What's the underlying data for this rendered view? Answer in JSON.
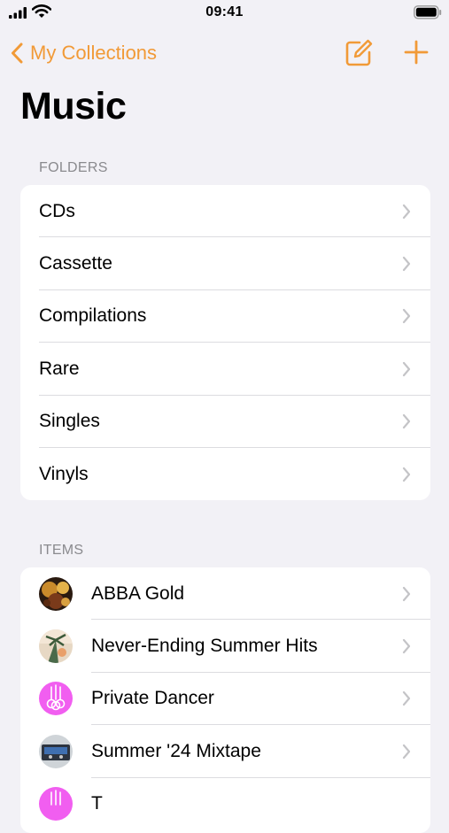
{
  "status_bar": {
    "time": "09:41"
  },
  "nav": {
    "back_label": "My Collections"
  },
  "page": {
    "title": "Music"
  },
  "folders": {
    "header": "FOLDERS",
    "items": [
      {
        "label": "CDs"
      },
      {
        "label": "Cassette"
      },
      {
        "label": "Compilations"
      },
      {
        "label": "Rare"
      },
      {
        "label": "Singles"
      },
      {
        "label": "Vinyls"
      }
    ]
  },
  "items": {
    "header": "ITEMS",
    "list": [
      {
        "label": "ABBA Gold",
        "thumb": "album-art-photo"
      },
      {
        "label": "Never-Ending Summer Hits",
        "thumb": "album-art-photo"
      },
      {
        "label": "Private Dancer",
        "thumb": "guitars-icon"
      },
      {
        "label": "Summer '24 Mixtape",
        "thumb": "album-art-photo"
      },
      {
        "label": "T",
        "thumb": "guitars-icon"
      }
    ]
  },
  "colors": {
    "accent": "#f19a37",
    "background": "#f2f1f6",
    "placeholder_magenta": "#f15ef0"
  }
}
